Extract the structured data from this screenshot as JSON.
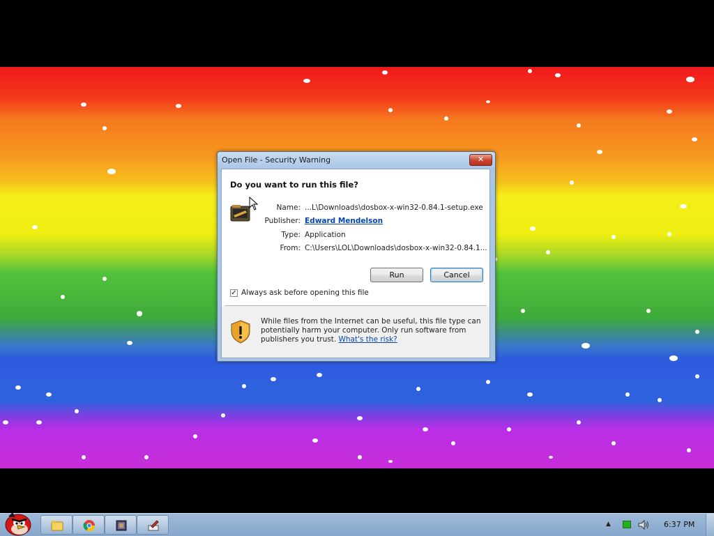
{
  "window": {
    "title": "Open File - Security Warning",
    "close_symbol": "✕"
  },
  "dialog": {
    "question": "Do you want to run this file?",
    "name_label": "Name:",
    "name_value": "...L\\Downloads\\dosbox-x-win32-0.84.1-setup.exe",
    "publisher_label": "Publisher:",
    "publisher_value": "Edward Mendelson",
    "type_label": "Type:",
    "type_value": "Application",
    "from_label": "From:",
    "from_value": "C:\\Users\\LOL\\Downloads\\dosbox-x-win32-0.84.1...",
    "run_label": "Run",
    "cancel_label": "Cancel",
    "checkbox_label": "Always ask before opening this file",
    "checkbox_checked": true,
    "checkbox_mark": "✓",
    "warning_text": "While files from the Internet can be useful, this file type can potentially harm your computer. Only run software from publishers you trust.",
    "risk_link": "What's the risk?"
  },
  "taskbar": {
    "clock": "6:37 PM",
    "tray_up_arrow": "▲",
    "icons": [
      "angry-bird-start-icon",
      "folder-icon",
      "chrome-icon",
      "app-icon",
      "paint-icon"
    ]
  },
  "colors": {
    "link": "#0645ad",
    "dialog_frame": "#a9c6e4",
    "taskbar": "#9fbad8"
  }
}
